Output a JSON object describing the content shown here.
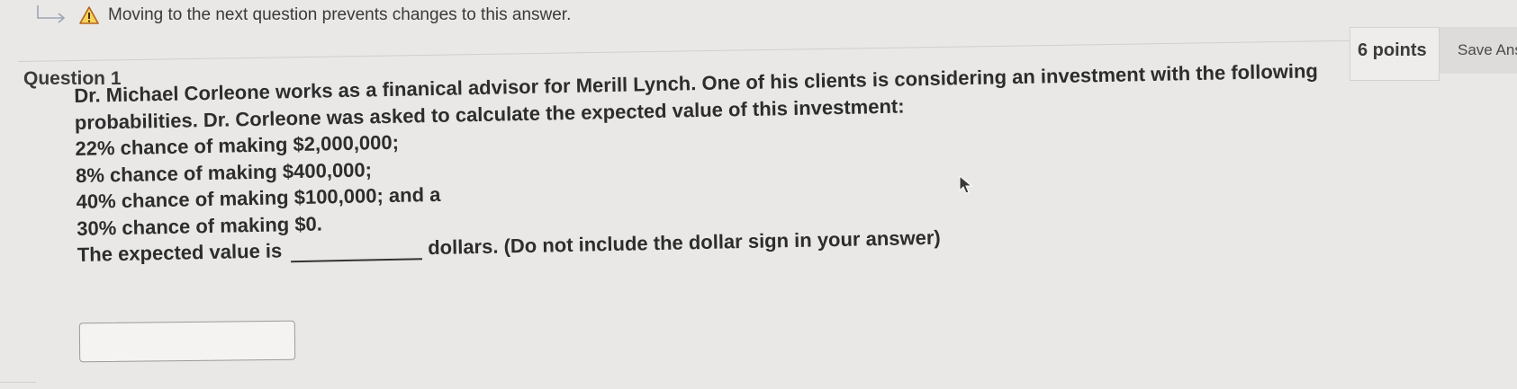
{
  "warning": {
    "text": "Moving to the next question prevents changes to this answer."
  },
  "question": {
    "title": "Question 1",
    "points": "6 points",
    "save_label": "Save Ans",
    "lines": [
      "Dr. Michael Corleone works as a finanical advisor for Merill Lynch. One of his clients is considering an investment with the following",
      "probabilities. Dr. Corleone was asked to calculate the expected value of this investment:",
      "22% chance of making $2,000,000;",
      "8% chance of making $400,000;",
      "40% chance of making $100,000; and a",
      "30% chance of making $0."
    ],
    "final_prefix": "The expected value is",
    "final_suffix": "dollars. (Do not include the dollar sign in your answer)",
    "answer_value": ""
  }
}
